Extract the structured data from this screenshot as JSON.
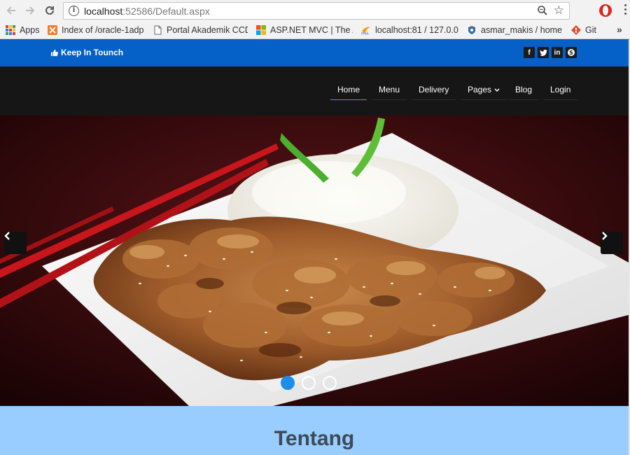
{
  "browser": {
    "url_host": "localhost",
    "url_path": ":52586/Default.aspx",
    "bookmarks": [
      {
        "label": "Apps",
        "icon": "apps-grid-icon"
      },
      {
        "label": "Index of /oracle-1adp",
        "icon": "xampp-icon"
      },
      {
        "label": "Portal Akademik CCDI",
        "icon": "page-icon"
      },
      {
        "label": "ASP.NET MVC | The A",
        "icon": "microsoft-icon"
      },
      {
        "label": "localhost:81 / 127.0.0.",
        "icon": "phpmyadmin-icon"
      },
      {
        "label": "asmar_makis / home -",
        "icon": "gogs-icon"
      },
      {
        "label": "Git",
        "icon": "git-icon"
      }
    ],
    "more_label": "»"
  },
  "topbar": {
    "keep_in_touch": "Keep In Tounch",
    "socials": [
      {
        "name": "facebook-icon",
        "glyph": "f"
      },
      {
        "name": "twitter-icon",
        "glyph": "t"
      },
      {
        "name": "linkedin-icon",
        "glyph": "in"
      },
      {
        "name": "skype-icon",
        "glyph": "S"
      }
    ]
  },
  "nav": {
    "items": [
      "Home",
      "Menu",
      "Delivery",
      "Pages",
      "Blog",
      "Login"
    ],
    "active": "Home"
  },
  "slider": {
    "prev": "‹",
    "next": "›",
    "slide_count": 3,
    "active_slide": 1
  },
  "about": {
    "title": "Tentang"
  },
  "colors": {
    "topbar": "#0560c8",
    "navbar": "#161616",
    "about_bg": "#99ccff",
    "active_dot": "#1e8de8"
  }
}
